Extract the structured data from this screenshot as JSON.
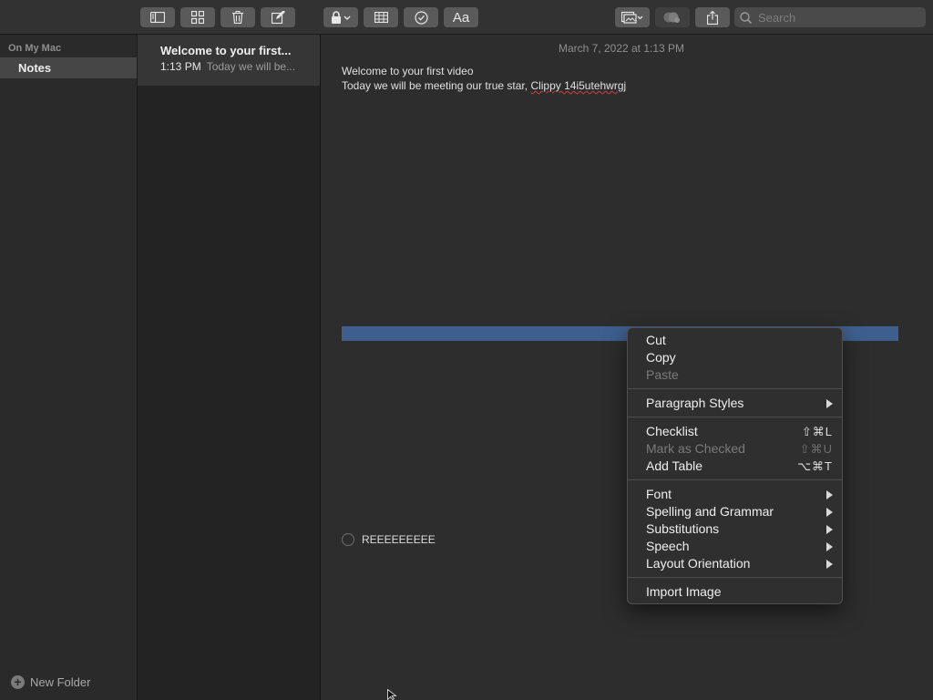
{
  "toolbar": {
    "search_placeholder": "Search",
    "icons": [
      "sidebar-toggle-icon",
      "gallery-view-icon",
      "trash-icon",
      "compose-icon",
      "lock-icon",
      "table-icon",
      "checklist-icon",
      "format-text-icon",
      "media-icon",
      "collaborate-icon",
      "share-icon",
      "search-icon"
    ],
    "format_label": "Aa"
  },
  "sidebar": {
    "section": "On My Mac",
    "items": [
      {
        "label": "Notes"
      }
    ],
    "new_folder": "New Folder"
  },
  "notelist": {
    "items": [
      {
        "title": "Welcome to your first...",
        "time": "1:13 PM",
        "snippet": "Today we will be..."
      }
    ]
  },
  "editor": {
    "date": "March 7, 2022 at 1:13 PM",
    "line1": "Welcome to your first video",
    "line2_prefix": "Today we will be meeting our true star, ",
    "line2_misspelled": "Clippy 14i5utehwrgj",
    "checklist_item": "REEEEEEEEE"
  },
  "context_menu": {
    "cut": "Cut",
    "copy": "Copy",
    "paste": "Paste",
    "paragraph_styles": "Paragraph Styles",
    "checklist": "Checklist",
    "checklist_shortcut": "⇧⌘L",
    "mark_as_checked": "Mark as Checked",
    "mark_as_checked_shortcut": "⇧⌘U",
    "add_table": "Add Table",
    "add_table_shortcut": "⌥⌘T",
    "font": "Font",
    "spelling_and_grammar": "Spelling and Grammar",
    "substitutions": "Substitutions",
    "speech": "Speech",
    "layout_orientation": "Layout Orientation",
    "import_image": "Import Image"
  },
  "colors": {
    "selection": "#3e5f8e",
    "menu_bg": "#2f2f2f",
    "sidebar_selected": "#464646"
  }
}
